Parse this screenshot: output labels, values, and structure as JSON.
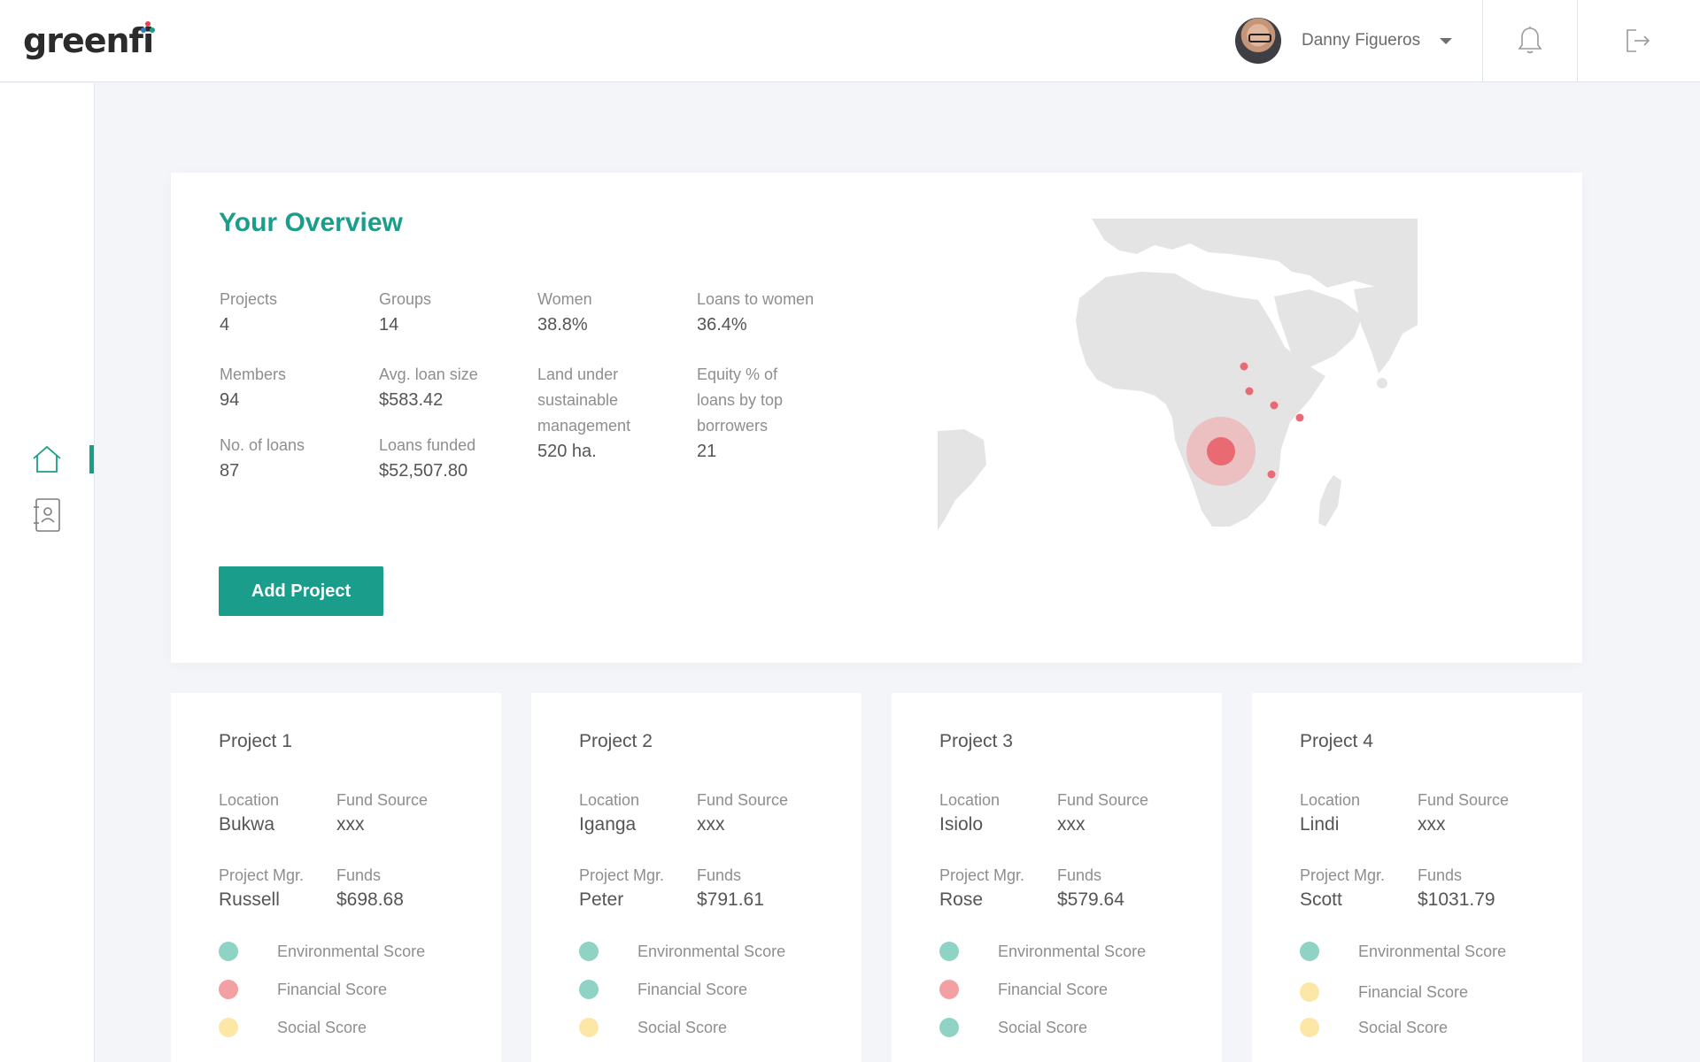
{
  "brand": {
    "logo_text": "greenfi"
  },
  "header": {
    "user_name": "Danny Figueros"
  },
  "colors": {
    "accent": "#1a9e8b",
    "green": "#8fd3c4",
    "red": "#f2a0a4",
    "yellow": "#fde7a6"
  },
  "icons": {
    "header": [
      "bell-icon",
      "logout-icon"
    ],
    "sidebar": [
      "home-icon",
      "contacts-icon"
    ]
  },
  "overview": {
    "title": "Your Overview",
    "stats": [
      {
        "label": "Projects",
        "value": "4"
      },
      {
        "label": "Groups",
        "value": "14"
      },
      {
        "label": "Women",
        "value": "38.8%"
      },
      {
        "label": "Loans to women",
        "value": "36.4%"
      },
      {
        "label": "Members",
        "value": "94"
      },
      {
        "label": "Avg. loan size",
        "value": "$583.42"
      },
      {
        "label": "Land under sustainable management",
        "value": "520 ha."
      },
      {
        "label": "Equity % of loans by top borrowers",
        "value": "21"
      },
      {
        "label": "No. of loans",
        "value": "87"
      },
      {
        "label": "Loans funded",
        "value": "$52,507.80"
      }
    ],
    "add_button": "Add Project"
  },
  "projects": [
    {
      "title": "Project 1",
      "location_label": "Location",
      "location": "Bukwa",
      "fund_source_label": "Fund Source",
      "fund_source": "xxx",
      "manager_label": "Project Mgr.",
      "manager": "Russell",
      "funds_label": "Funds",
      "funds": "$698.68",
      "scores": [
        {
          "label": "Environmental Score",
          "color": "#8fd3c4"
        },
        {
          "label": "Financial Score",
          "color": "#f2a0a4"
        },
        {
          "label": "Social Score",
          "color": "#fde7a6"
        }
      ]
    },
    {
      "title": "Project 2",
      "location_label": "Location",
      "location": "Iganga",
      "fund_source_label": "Fund Source",
      "fund_source": "xxx",
      "manager_label": "Project Mgr.",
      "manager": "Peter",
      "funds_label": "Funds",
      "funds": "$791.61",
      "scores": [
        {
          "label": "Environmental Score",
          "color": "#8fd3c4"
        },
        {
          "label": "Financial Score",
          "color": "#8fd3c4"
        },
        {
          "label": "Social Score",
          "color": "#fde7a6"
        }
      ]
    },
    {
      "title": "Project 3",
      "location_label": "Location",
      "location": "Isiolo",
      "fund_source_label": "Fund Source",
      "fund_source": "xxx",
      "manager_label": "Project Mgr.",
      "manager": "Rose",
      "funds_label": "Funds",
      "funds": "$579.64",
      "scores": [
        {
          "label": "Environmental Score",
          "color": "#8fd3c4"
        },
        {
          "label": "Financial Score",
          "color": "#f2a0a4"
        },
        {
          "label": "Social Score",
          "color": "#8fd3c4"
        }
      ]
    },
    {
      "title": "Project 4",
      "location_label": "Location",
      "location": "Lindi",
      "fund_source_label": "Fund Source",
      "fund_source": "xxx",
      "manager_label": "Project Mgr.",
      "manager": "Scott",
      "funds_label": "Funds",
      "funds": "$1031.79",
      "scores": [
        {
          "label": "Environmental Score",
          "color": "#8fd3c4"
        },
        {
          "label": "Financial Score",
          "color": "#fde7a6"
        },
        {
          "label": "Social Score",
          "color": "#fde7a6"
        }
      ]
    }
  ]
}
